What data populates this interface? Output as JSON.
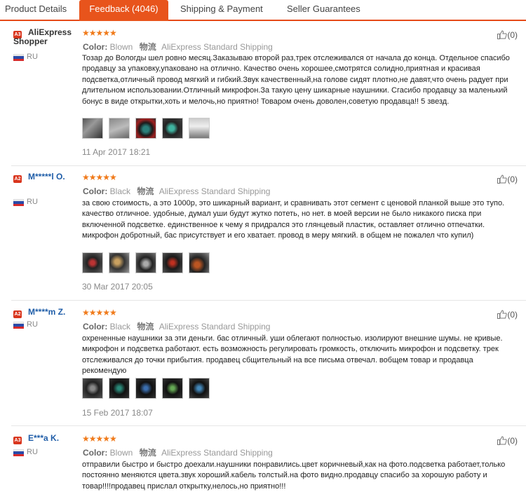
{
  "tabs": [
    {
      "label": "Product Details"
    },
    {
      "label": "Feedback (4046)"
    },
    {
      "label": "Shipping & Payment"
    },
    {
      "label": "Seller Guarantees"
    }
  ],
  "colors": {
    "accent": "#e8541c",
    "star": "#f07a1a",
    "level_badge": "#d9361e",
    "buyer_name_blue": "#1f5da8"
  },
  "reviews": [
    {
      "level": "A3",
      "buyer": "AliExpress Shopper",
      "country": "RU",
      "stars": "★★★★★",
      "color_label": "Color:",
      "color_value": "Blown",
      "logistics_label": "物流",
      "logistics_value": "AliExpress Standard Shipping",
      "text": "Тозар до Вологды шел ровно месяц.Заказываю второй раз,трек отслеживался от начала до конца. Отдельное спасибо продавцу за упаковку,упаковано на отлично. Качество очень хорошее,смотрятся солидно,приятная и красивая подсветка,отличный провод мягкий и гибкий.Звук качественный,на голове сидят плотно,не давят,что очень радует при длительном использовании.Отличный микрофон.За такую цену шикарные наушники. Сгасибо продавцу за маленький бонус в виде открытки,хоть и мелочь,но приятно! Товаром очень доволен,советую продавца!! 5 звезд.",
      "date": "11 Apr 2017 18:21",
      "helpful": "(0)",
      "photos": 5
    },
    {
      "level": "A2",
      "buyer": "M*****l O.",
      "country": "RU",
      "stars": "★★★★★",
      "color_label": "Color:",
      "color_value": "Black",
      "logistics_label": "物流",
      "logistics_value": "AliExpress Standard Shipping",
      "text": "за свою стоимость, а это 1000р, это шикарный вариант, и сравнивать этот сегмент с ценовой планкой выше это тупо. качество отличное. удобные, думал уши будут жутко потеть, но нет. в моей версии не было никакого писка при включенной подсветке. единственное к чему я придрался это глянцевый пластик, оставляет отлично отпечатки. микрофон добротный, бас присутствует и его хватает. провод в меру мягкий. в общем не пожалел что купил)",
      "date": "30 Mar 2017 20:05",
      "helpful": "(0)",
      "photos": 5
    },
    {
      "level": "A2",
      "buyer": "M****m Z.",
      "country": "RU",
      "stars": "★★★★★",
      "color_label": "Color:",
      "color_value": "Black",
      "logistics_label": "物流",
      "logistics_value": "AliExpress Standard Shipping",
      "text": "охрененные наушники за эти деньги. бас отличный. уши облегают полностью. изолируют внешние шумы. не кривые. микрофон и подсветка работают. есть возможность регулировать громкость, отключить микрофон и подсветку. трек отслеживался до точки прибытия. продавец сбщительный на все письма отвечал. вобщем товар и продавца рекомендую",
      "date": "15 Feb 2017 18:07",
      "helpful": "(0)",
      "photos": 5
    },
    {
      "level": "A3",
      "buyer": "E***a K.",
      "country": "RU",
      "stars": "★★★★★",
      "color_label": "Color:",
      "color_value": "Blown",
      "logistics_label": "物流",
      "logistics_value": "AliExpress Standard Shipping",
      "text": "отправили быстро и быстро доехали.наушники понравились.цвет коричневый,как на фото.подсветка работает,только постоянно меняются цвета.звук хороший.кабель толстый.на фото видно.продавцу спасибо за хорошую работу и товар!!!!продавец прислал открытку,нелось,но приятно!!!",
      "helpful": "(0)"
    }
  ]
}
